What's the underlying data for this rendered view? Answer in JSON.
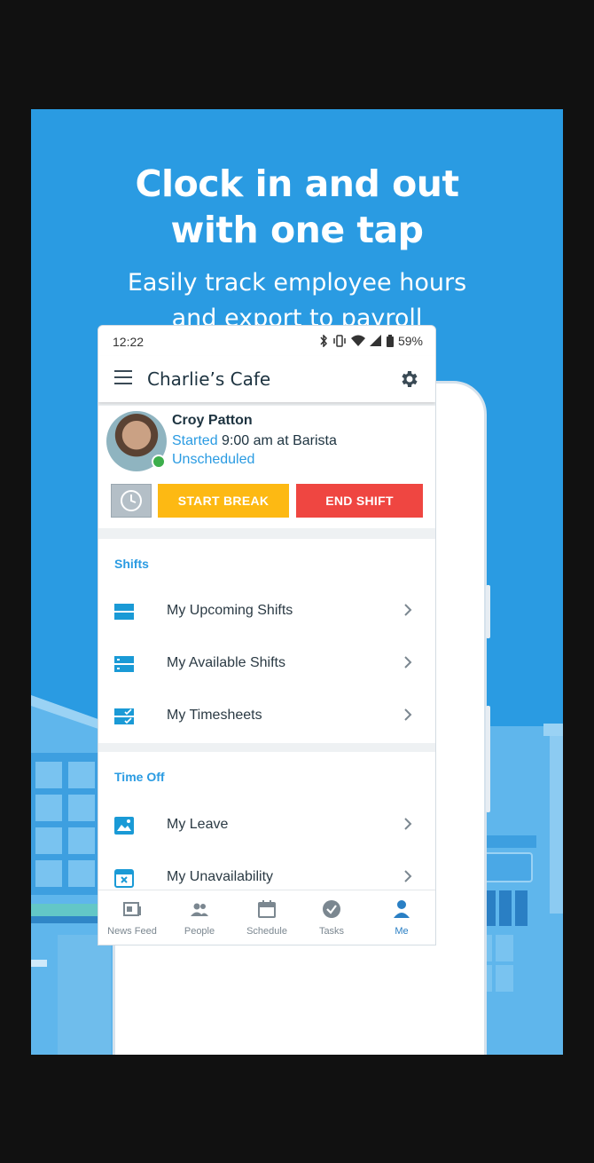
{
  "colors": {
    "brand": "#2a9be2",
    "break_button": "#fdb913",
    "end_button": "#ef4641",
    "online": "#3cae4b"
  },
  "promo": {
    "headline_line1": "Clock in and out",
    "headline_line2": "with one tap",
    "subline_line1": "Easily track employee hours",
    "subline_line2": "and export to payroll"
  },
  "status_bar": {
    "time": "12:22",
    "battery": "59%",
    "icons": [
      "bluetooth-icon",
      "vibrate-icon",
      "wifi-icon",
      "signal-icon",
      "battery-icon"
    ]
  },
  "app_bar": {
    "title": "Charlie’s Cafe",
    "menu_icon": "hamburger-menu-icon",
    "settings_icon": "gear-icon"
  },
  "profile": {
    "name": "Croy Patton",
    "status_prefix": "Started",
    "status_rest": " 9:00 am at Barista",
    "schedule": "Unscheduled",
    "online": true,
    "start_break_label": "START BREAK",
    "end_shift_label": "END SHIFT"
  },
  "shifts": {
    "title": "Shifts",
    "items": [
      {
        "label": "My Upcoming Shifts",
        "icon": "upcoming-shifts-icon"
      },
      {
        "label": "My Available Shifts",
        "icon": "available-shifts-icon"
      },
      {
        "label": "My Timesheets",
        "icon": "timesheets-icon"
      }
    ]
  },
  "time_off": {
    "title": "Time Off",
    "items": [
      {
        "label": "My Leave",
        "icon": "leave-icon"
      },
      {
        "label": "My Unavailability",
        "icon": "unavailability-icon"
      }
    ]
  },
  "tabs": [
    {
      "label": "News Feed",
      "icon": "news-feed-icon",
      "active": false
    },
    {
      "label": "People",
      "icon": "people-icon",
      "active": false
    },
    {
      "label": "Schedule",
      "icon": "calendar-icon",
      "active": false
    },
    {
      "label": "Tasks",
      "icon": "check-circle-icon",
      "active": false
    },
    {
      "label": "Me",
      "icon": "person-icon",
      "active": true
    }
  ]
}
